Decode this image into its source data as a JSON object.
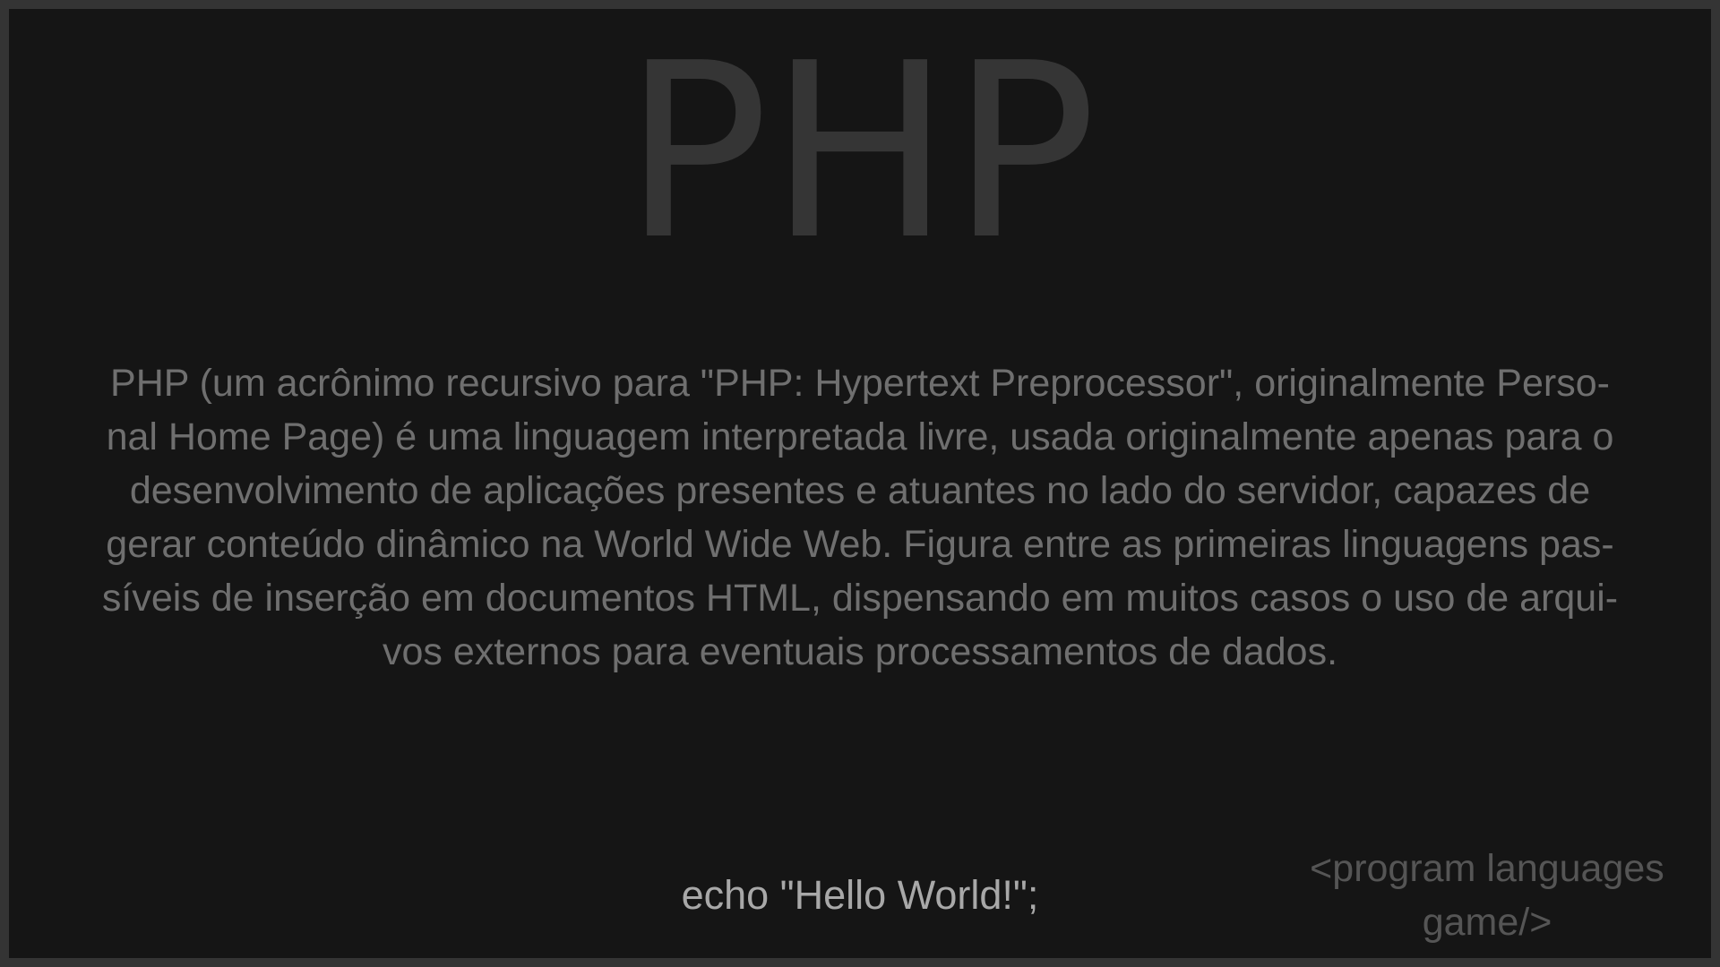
{
  "title": "PHP",
  "description": "PHP (um acrônimo recursivo para \"PHP: Hypertext Preprocessor\", originalmente Perso-\nnal Home Page) é uma linguagem interpretada livre, usada originalmente apenas para o\ndesenvolvimento de aplicações presentes e atuantes no lado do servidor, capazes de\ngerar conteúdo dinâmico na World Wide Web. Figura entre as primeiras linguagens pas-\nsíveis de inserção em documentos HTML, dispensando em muitos casos o uso de arqui-\nvos externos para eventuais processamentos de dados.",
  "code": "echo \"Hello World!\";",
  "game_tag": "<program languages\ngame/>",
  "colors": {
    "background": "#151515",
    "frame": "#343434",
    "title": "#353535",
    "description": "#6f6f6f",
    "code": "#a8a8a8",
    "tag": "#555555"
  }
}
